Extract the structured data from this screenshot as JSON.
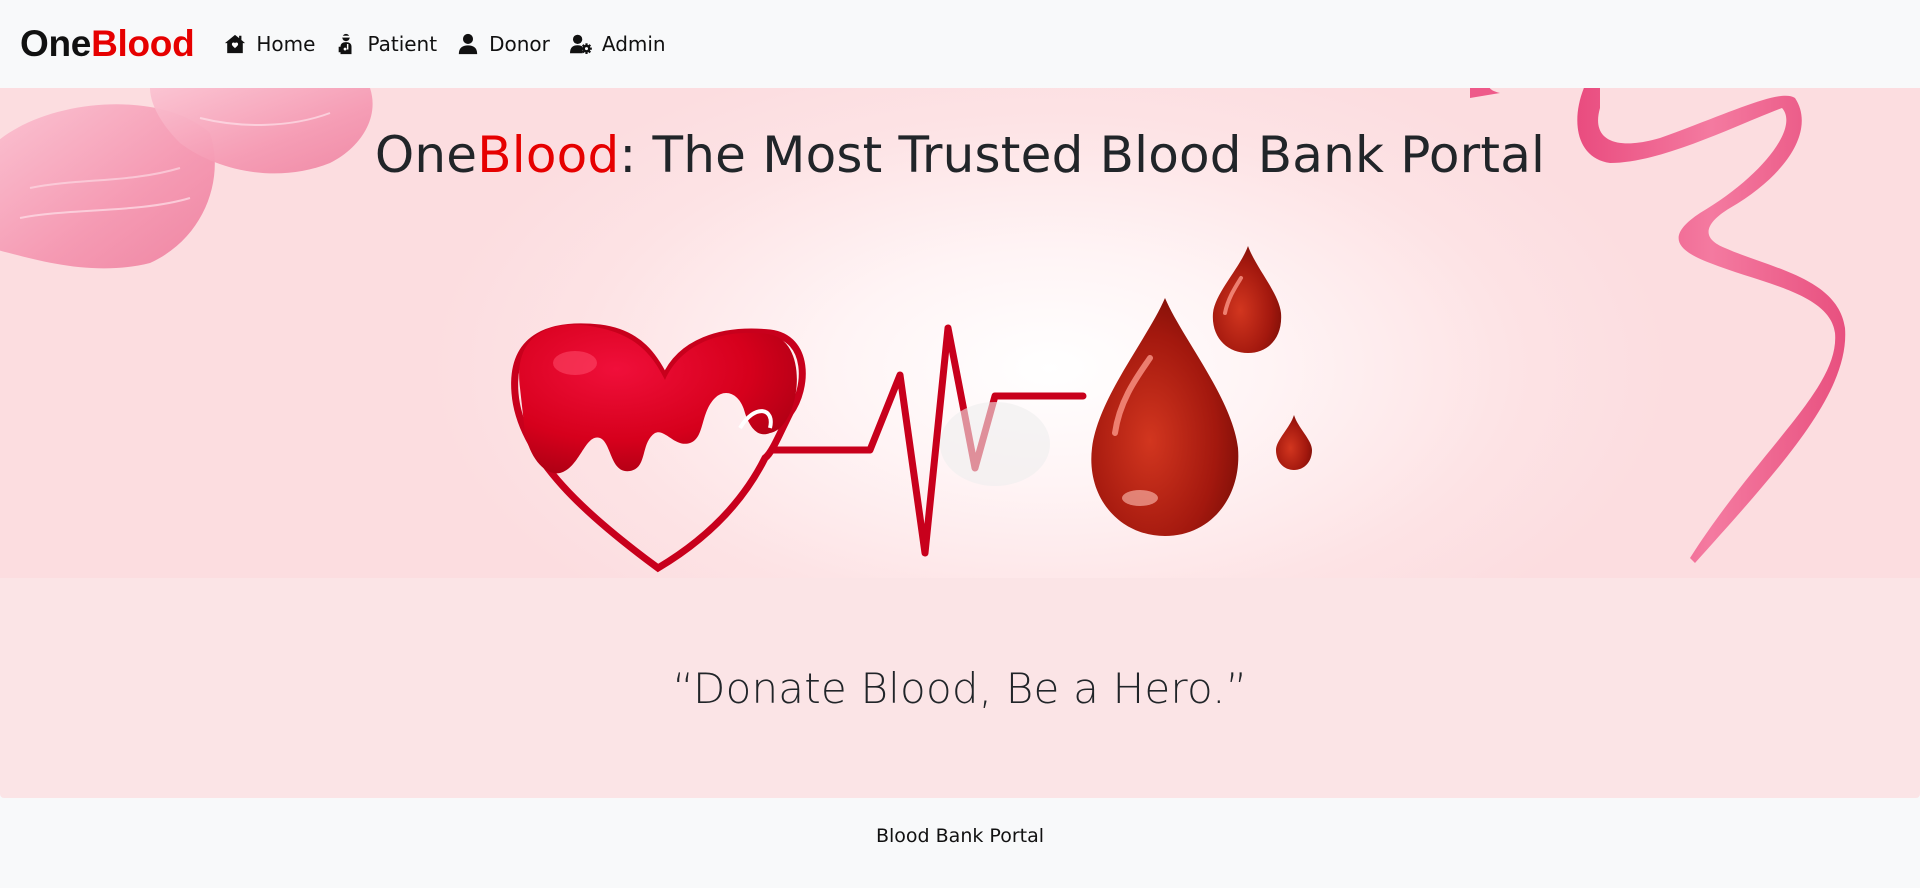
{
  "navbar": {
    "brand_part1": "One",
    "brand_part2": "Blood",
    "items": [
      {
        "label": "Home",
        "icon": "house-icon"
      },
      {
        "label": "Patient",
        "icon": "patient-icon"
      },
      {
        "label": "Donor",
        "icon": "user-icon"
      },
      {
        "label": "Admin",
        "icon": "user-gear-icon"
      }
    ]
  },
  "hero": {
    "title_part1": "One",
    "title_part2": "Blood",
    "title_part3": ": The Most Trusted Blood Bank Portal"
  },
  "quote": {
    "text": "“Donate Blood, Be a Hero.”"
  },
  "footer": {
    "text": "Blood Bank Portal"
  },
  "colors": {
    "brand_red": "#e60000",
    "hero_bg": "#fde3e5",
    "quote_bg": "#fbe4e6",
    "blood_dark": "#a81a12",
    "heart_red": "#d40019",
    "ribbon_pink": "#f06292"
  }
}
